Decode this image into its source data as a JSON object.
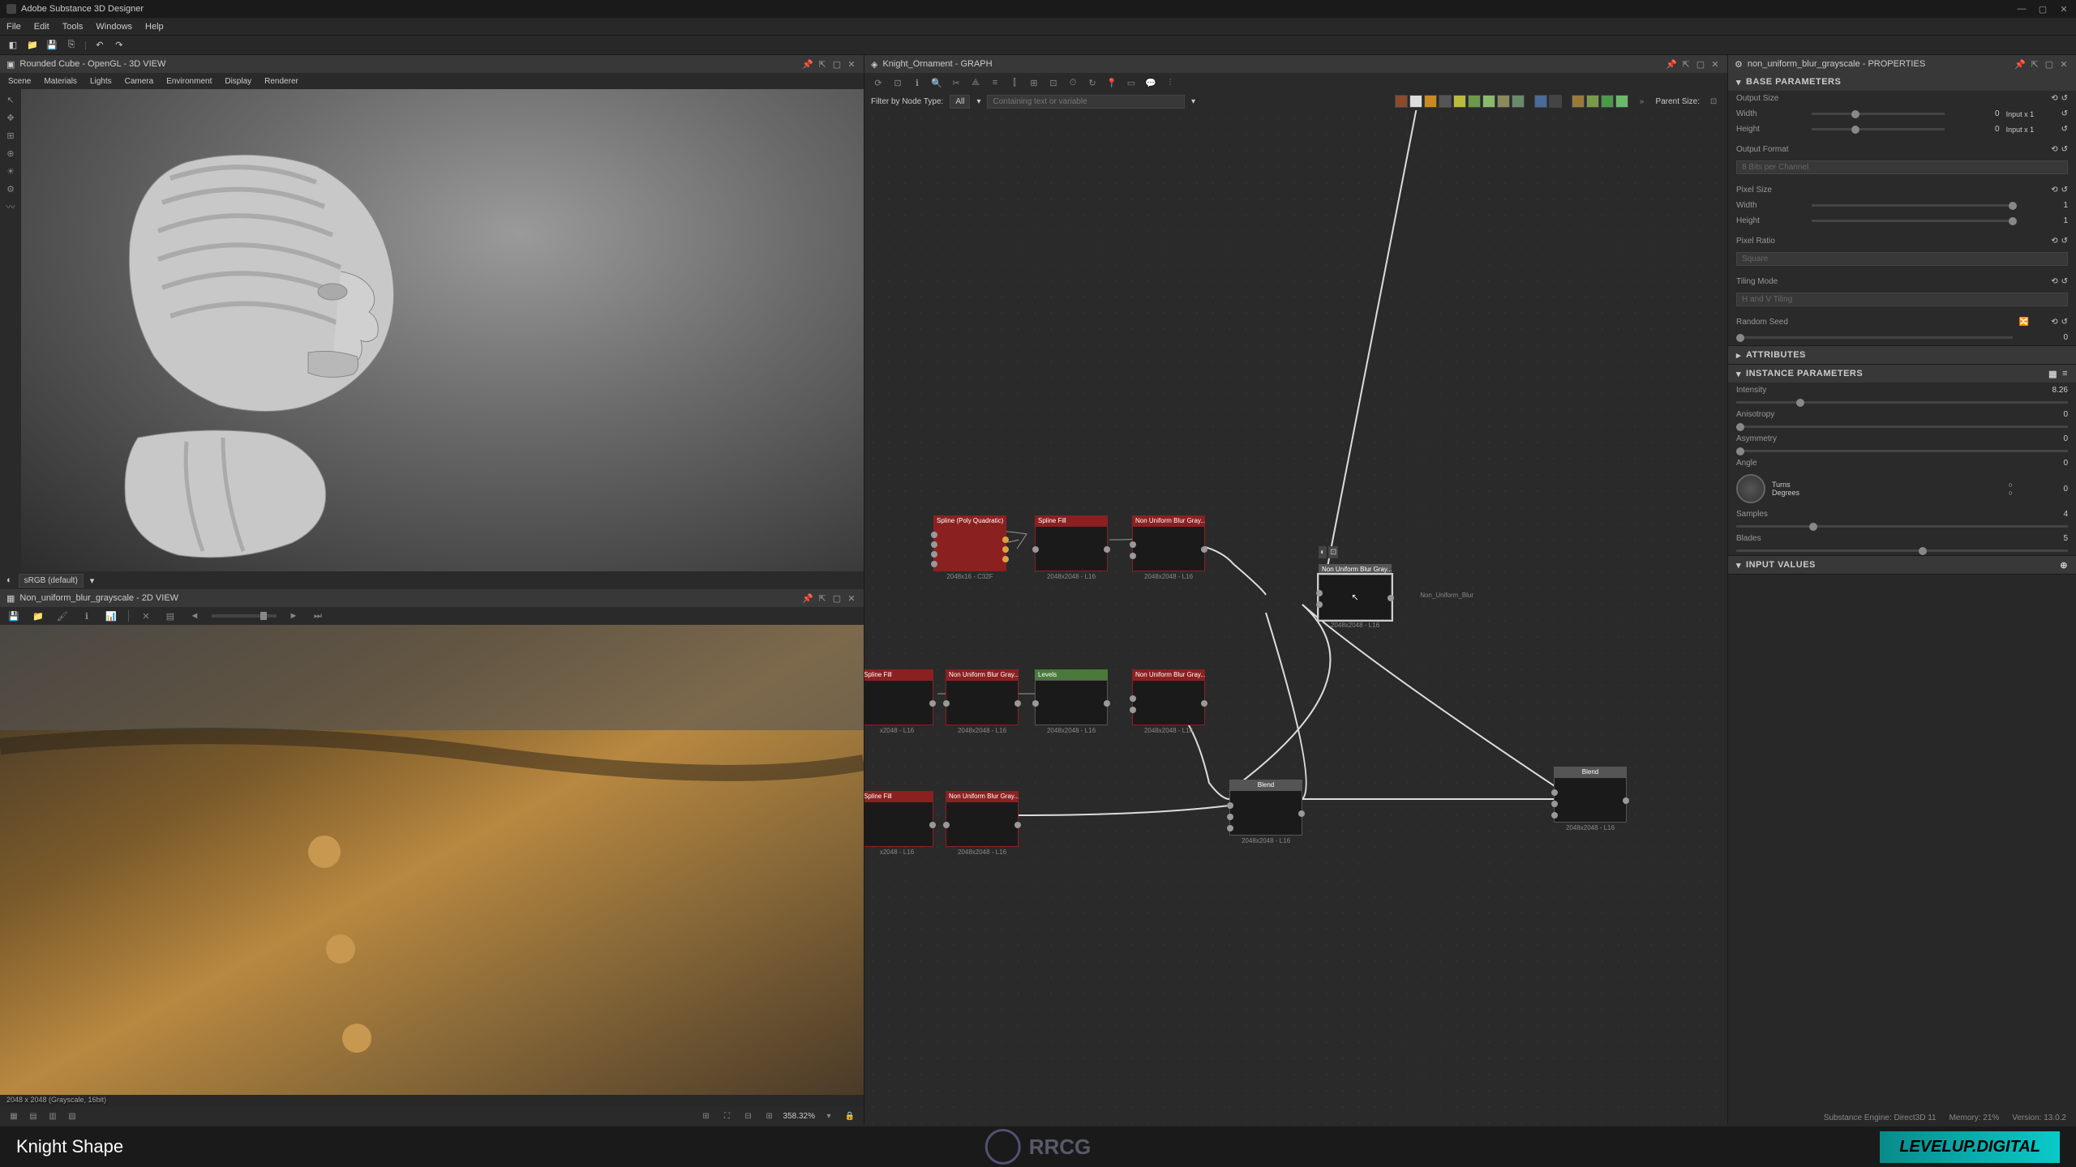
{
  "app": {
    "title": "Adobe Substance 3D Designer",
    "menus": [
      "File",
      "Edit",
      "Tools",
      "Windows",
      "Help"
    ]
  },
  "viewport3d": {
    "title": "Rounded Cube - OpenGL - 3D VIEW",
    "submenu": [
      "Scene",
      "Materials",
      "Lights",
      "Camera",
      "Environment",
      "Display",
      "Renderer"
    ],
    "colorspace": "sRGB (default)"
  },
  "viewport2d": {
    "title": "Non_uniform_blur_grayscale - 2D VIEW",
    "info": "2048 x 2048 (Grayscale, 16bit)",
    "zoom": "358.32%"
  },
  "graph": {
    "title": "Knight_Ornament - GRAPH",
    "filter_label": "Filter by Node Type:",
    "filter_type": "All",
    "filter_text_label": "Containing text or variable",
    "parent_size_label": "Parent Size:",
    "nodes": [
      {
        "id": "n1",
        "label": "Spline (Poly Quadratic)",
        "info": "2048x16 - C32F",
        "type": "red"
      },
      {
        "id": "n2",
        "label": "Spline Fill",
        "info": "2048x2048 - L16",
        "type": "red"
      },
      {
        "id": "n3",
        "label": "Non Uniform Blur Gray...",
        "info": "2048x2048 - L16",
        "type": "red"
      },
      {
        "id": "n4",
        "label": "Spline Fill",
        "info": "x2048 - L16",
        "type": "red"
      },
      {
        "id": "n5",
        "label": "Non Uniform Blur Gray...",
        "info": "2048x2048 - L16",
        "type": "red"
      },
      {
        "id": "n6",
        "label": "Levels",
        "info": "2048x2048 - L16",
        "type": "green"
      },
      {
        "id": "n7",
        "label": "Non Uniform Blur Gray...",
        "info": "2048x2048 - L16",
        "type": "red"
      },
      {
        "id": "n8",
        "label": "Spline Fill",
        "info": "x2048 - L16",
        "type": "red"
      },
      {
        "id": "n9",
        "label": "Non Uniform Blur Gray...",
        "info": "2048x2048 - L16",
        "type": "red"
      },
      {
        "id": "n10",
        "label": "Non Uniform Blur Gray...",
        "info": "2048x2048 - L16",
        "type": "gray",
        "selected": true,
        "tooltip": "Non_Uniform_Blur"
      },
      {
        "id": "n11",
        "label": "Blend",
        "info": "2048x2048 - L16",
        "type": "gray"
      },
      {
        "id": "n12",
        "label": "Blend",
        "info": "2048x2048 - L16",
        "type": "gray"
      }
    ]
  },
  "properties": {
    "title": "non_uniform_blur_grayscale - PROPERTIES",
    "sections": {
      "base": {
        "title": "BASE PARAMETERS",
        "output_size": {
          "label": "Output Size",
          "width_label": "Width",
          "width_val": "0",
          "width_mode": "Input x 1",
          "height_label": "Height",
          "height_val": "0",
          "height_mode": "Input x 1"
        },
        "output_format": {
          "label": "Output Format",
          "value": "8 Bits per Channel"
        },
        "pixel_size": {
          "label": "Pixel Size",
          "width_label": "Width",
          "width_val": "1",
          "height_label": "Height",
          "height_val": "1"
        },
        "pixel_ratio": {
          "label": "Pixel Ratio",
          "value": "Square"
        },
        "tiling_mode": {
          "label": "Tiling Mode",
          "value": "H and V Tiling"
        },
        "random_seed": {
          "label": "Random Seed",
          "value": "0"
        }
      },
      "attributes": {
        "title": "ATTRIBUTES"
      },
      "instance": {
        "title": "INSTANCE PARAMETERS",
        "intensity": {
          "label": "Intensity",
          "value": "8.26"
        },
        "anisotropy": {
          "label": "Anisotropy",
          "value": "0"
        },
        "asymmetry": {
          "label": "Asymmetry",
          "value": "0"
        },
        "angle": {
          "label": "Angle",
          "turns_label": "Turns",
          "turns_val": "0",
          "degrees_label": "Degrees",
          "degrees_val": "0"
        },
        "samples": {
          "label": "Samples",
          "value": "4"
        },
        "blades": {
          "label": "Blades",
          "value": "5"
        }
      },
      "input_values": {
        "title": "INPUT VALUES"
      }
    }
  },
  "status": {
    "engine": "Substance Engine: Direct3D 11",
    "memory": "Memory: 21%",
    "version": "Version: 13.0.2"
  },
  "video": {
    "caption": "Knight Shape",
    "brand": "LEVELUP.DIGITAL",
    "watermark": "RRCG"
  }
}
